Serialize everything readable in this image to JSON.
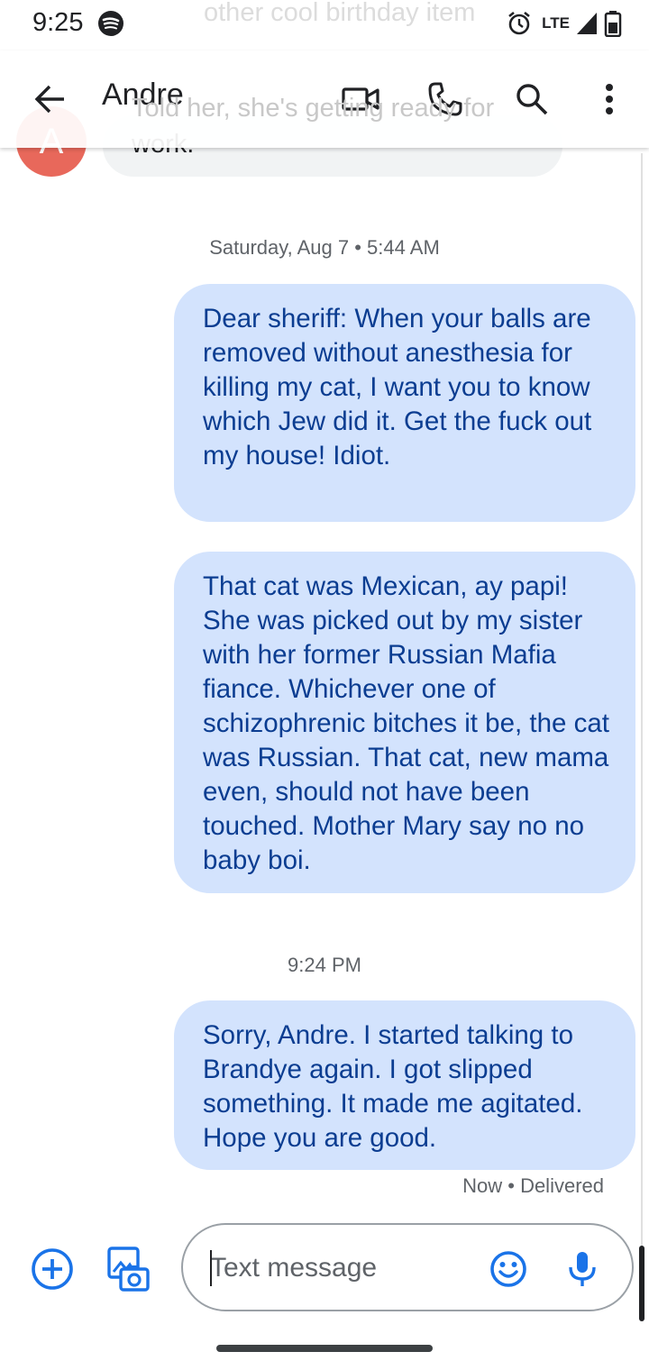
{
  "status_bar": {
    "time": "9:25",
    "network": "LTE",
    "icons": [
      "spotify-icon",
      "alarm-icon",
      "signal-icon",
      "battery-icon"
    ]
  },
  "behind_header": {
    "line1": "other cool birthday item",
    "line2": "Told her, she's getting ready for",
    "line3": "work.",
    "avatar_letter": "A"
  },
  "app_bar": {
    "contact_name": "Andre",
    "actions": [
      "back-arrow-icon",
      "video-call-icon",
      "phone-icon",
      "search-icon",
      "more-vert-icon"
    ]
  },
  "messages": {
    "date_label_1": "Saturday, Aug 7 • 5:44 AM",
    "message_1": "Dear sheriff: When your balls are removed without anesthesia for killing my cat, I want you to know which Jew did it. Get the fuck out my house! Idiot.",
    "message_2": "That cat was Mexican, ay papi! She was picked out by my sister with her former Russian Mafia fiance. Whichever one of schizophrenic bitches it be, the cat was Russian. That cat, new mama even, should not have been touched. Mother Mary say no no baby boi.",
    "date_label_2": "9:24 PM",
    "message_3": "Sorry, Andre. I started talking to Brandye again. I got slipped something. It made me agitated. Hope you are good.",
    "status": "Now • Delivered"
  },
  "composer": {
    "placeholder": "Text message",
    "icons": [
      "add-circle-icon",
      "gallery-camera-icon",
      "emoji-icon",
      "microphone-icon"
    ]
  },
  "colors": {
    "accent": "#1a73e8",
    "bubble_bg": "#d3e3fd",
    "bubble_text": "#0b3d91",
    "avatar": "#e8685b"
  }
}
